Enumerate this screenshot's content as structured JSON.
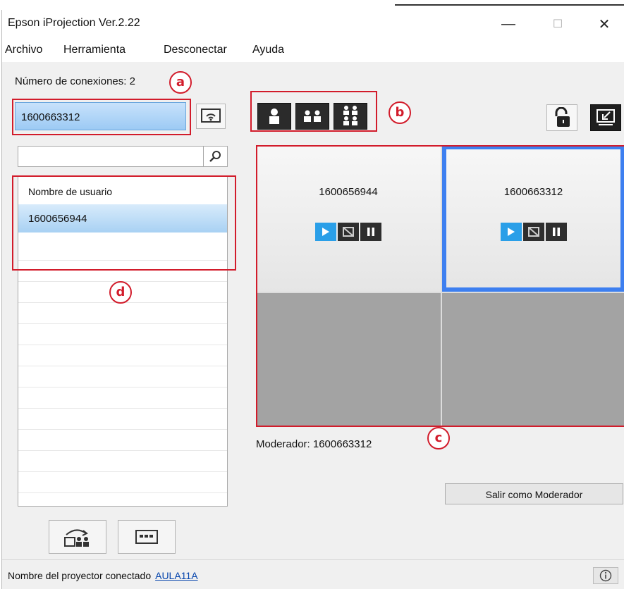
{
  "window": {
    "title": "Epson iProjection Ver.2.22",
    "controls": {
      "minimize": "—",
      "maximize": "☐",
      "close": "✕"
    }
  },
  "menu": [
    "Archivo",
    "Herramienta",
    "Desconectar",
    "Ayuda"
  ],
  "left": {
    "connections_label": "Número de conexiones: 2",
    "current_user": "1600663312",
    "search_placeholder": "",
    "list_header": "Nombre de usuario",
    "users": [
      "1600656944"
    ]
  },
  "panels": [
    {
      "name": "1600656944",
      "selected": false
    },
    {
      "name": "1600663312",
      "selected": true
    }
  ],
  "moderator_label": "Moderador: 1600663312",
  "exit_moderator_label": "Salir como Moderador",
  "status": {
    "label": "Nombre del proyector conectado",
    "projector": "AULA11A"
  },
  "callouts": {
    "a": "a",
    "b": "b",
    "c": "c",
    "d": "d"
  },
  "icons": [
    "wifi-screen-icon",
    "search-icon",
    "layout-single-icon",
    "layout-two-icon",
    "layout-four-icon",
    "lock-open-icon",
    "minimize-window-icon",
    "play-icon",
    "stop-display-icon",
    "pause-icon",
    "distribute-users-icon",
    "keyboard-icon",
    "info-icon"
  ],
  "colors": {
    "selection_frame": "#3d7ff0",
    "callout_red": "#d21c2b",
    "play_blue": "#2a9fe8"
  }
}
